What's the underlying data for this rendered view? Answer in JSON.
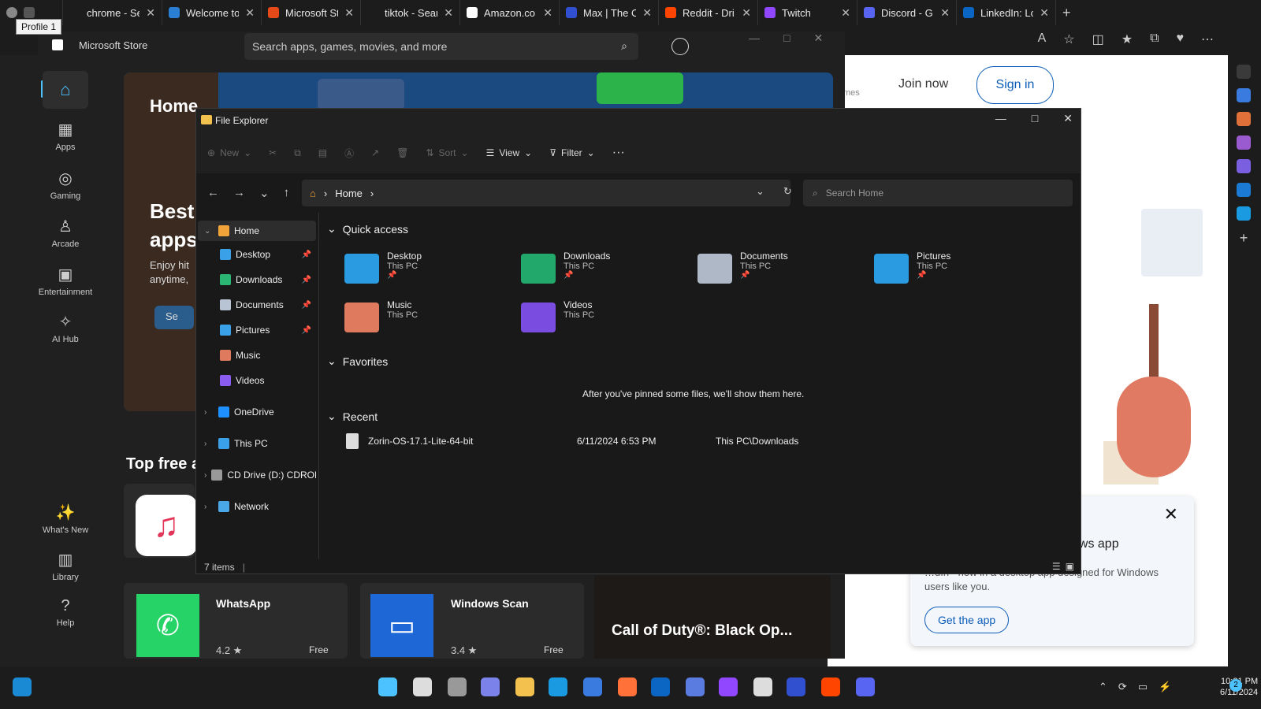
{
  "browser": {
    "tabs": [
      {
        "title": "chrome - Se",
        "color": "#1c1c1c"
      },
      {
        "title": "Welcome to",
        "color": "#2a7fd4"
      },
      {
        "title": "Microsoft St",
        "color": "#e64a19"
      },
      {
        "title": "tiktok - Sear",
        "color": "#1c1c1c"
      },
      {
        "title": "Amazon.co",
        "color": "#ffffff"
      },
      {
        "title": "Max | The O",
        "color": "#3050d0"
      },
      {
        "title": "Reddit - Dri",
        "color": "#ff4500"
      },
      {
        "title": "Twitch",
        "color": "#9146ff"
      },
      {
        "title": "Discord - G",
        "color": "#5865f2"
      },
      {
        "title": "LinkedIn: Lo",
        "color": "#0a66c2"
      }
    ],
    "profile_tooltip": "Profile 1"
  },
  "webpage": {
    "games_partial": "mes",
    "join_now": "Join now",
    "sign_in": "Sign in",
    "popup_title": "ows app",
    "popup_text": "…dIn - now in a desktop app designed for Windows users like you.",
    "popup_cta": "Get the app"
  },
  "store": {
    "app_title": "Microsoft Store",
    "search_placeholder": "Search apps, games, movies, and more",
    "nav": [
      {
        "label": "Apps",
        "icon": "apps-icon"
      },
      {
        "label": "Gaming",
        "icon": "gaming-icon"
      },
      {
        "label": "Arcade",
        "icon": "arcade-icon"
      },
      {
        "label": "Entertainment",
        "icon": "entertainment-icon"
      },
      {
        "label": "AI Hub",
        "icon": "ai-hub-icon"
      },
      {
        "label": "What's New",
        "icon": "whats-new-icon"
      },
      {
        "label": "Library",
        "icon": "library-icon"
      },
      {
        "label": "Help",
        "icon": "help-icon"
      }
    ],
    "hero_title": "Home",
    "hero_best_1": "Best",
    "hero_best_2": "apps",
    "hero_sub": "Enjoy hit anytime,",
    "hero_btn": "Se",
    "top_free": "Top free a",
    "apps": [
      {
        "name": "WhatsApp",
        "rating": "4.2 ★",
        "price": "Free"
      },
      {
        "name": "Windows Scan",
        "rating": "3.4 ★",
        "price": "Free"
      }
    ],
    "featured": "Call of Duty®: Black Op..."
  },
  "explorer": {
    "title": "File Explorer",
    "cmd": {
      "new": "New",
      "sort": "Sort",
      "view": "View",
      "filter": "Filter",
      "more": "···"
    },
    "address": {
      "location": "Home"
    },
    "search_placeholder": "Search Home",
    "tree": [
      {
        "label": "Home",
        "color": "#f2a33a"
      },
      {
        "label": "Desktop",
        "color": "#3aa0e8"
      },
      {
        "label": "Downloads",
        "color": "#2bb673"
      },
      {
        "label": "Documents",
        "color": "#b8c4d4"
      },
      {
        "label": "Pictures",
        "color": "#3aa0e8"
      },
      {
        "label": "Music",
        "color": "#e07a5f"
      },
      {
        "label": "Videos",
        "color": "#8a5cf0"
      },
      {
        "label": "OneDrive",
        "color": "#1e90ff"
      },
      {
        "label": "This PC",
        "color": "#3aa0e8"
      },
      {
        "label": "CD Drive (D:) CDROM",
        "color": "#999999"
      },
      {
        "label": "Network",
        "color": "#4aa8e8"
      }
    ],
    "quick_access_label": "Quick access",
    "quick_access": [
      {
        "name": "Desktop",
        "sub": "This PC",
        "color": "#2a9be0",
        "pinned": true
      },
      {
        "name": "Downloads",
        "sub": "This PC",
        "color": "#22a86a",
        "pinned": true
      },
      {
        "name": "Documents",
        "sub": "This PC",
        "color": "#aeb8c6",
        "pinned": true
      },
      {
        "name": "Pictures",
        "sub": "This PC",
        "color": "#2a9be0",
        "pinned": true
      },
      {
        "name": "Music",
        "sub": "This PC",
        "color": "#e07a5f",
        "pinned": false
      },
      {
        "name": "Videos",
        "sub": "This PC",
        "color": "#7a4ce0",
        "pinned": false
      }
    ],
    "favorites_label": "Favorites",
    "favorites_empty": "After you've pinned some files, we'll show them here.",
    "recent_label": "Recent",
    "recent": [
      {
        "name": "Zorin-OS-17.1-Lite-64-bit",
        "date": "6/11/2024 6:53 PM",
        "location": "This PC\\Downloads"
      }
    ],
    "status": "7 items"
  },
  "taskbar": {
    "time": "10:21 PM",
    "date": "6/11/2024",
    "notifications": "2"
  }
}
